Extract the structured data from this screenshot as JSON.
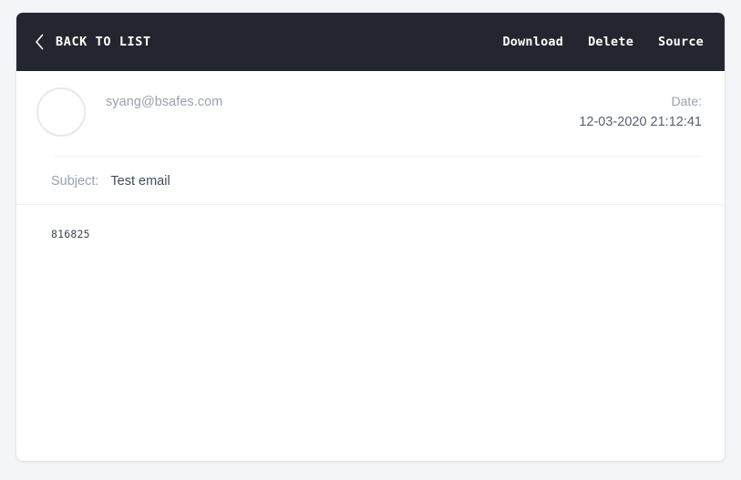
{
  "theme": {
    "page_background": "#f4f5f8",
    "card_background": "#ffffff",
    "toolbar_background": "#24262f",
    "toolbar_text": "#ffffff",
    "muted_text": "#9aa0b0",
    "body_text": "#3d4352",
    "avatar_border": "#e7e7f1",
    "divider": "#eff0f5"
  },
  "toolbar": {
    "back_icon": "chevron-left-icon",
    "back_label": "BACK TO LIST",
    "actions": [
      {
        "name": "download",
        "label": "Download"
      },
      {
        "name": "delete",
        "label": "Delete"
      },
      {
        "name": "source",
        "label": "Source"
      }
    ]
  },
  "message": {
    "avatar_icon": "avatar-placeholder-circle",
    "sender_email": "syang@bsafes.com",
    "date_label": "Date:",
    "date_value": "12-03-2020 21:12:41",
    "subject_label": "Subject:",
    "subject_value": "Test email",
    "body": "816825"
  }
}
